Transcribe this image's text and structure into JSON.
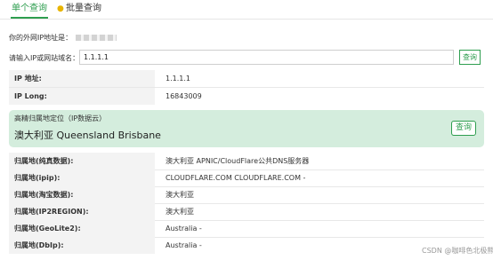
{
  "tabs": {
    "single_label": "单个查询",
    "batch_label": "批量查询"
  },
  "your_ip": {
    "label": "你的外网IP地址是："
  },
  "query": {
    "label": "请输入IP或网站域名：",
    "value": "1.1.1.1",
    "button_label": "查询"
  },
  "basic_rows": [
    {
      "key": "IP 地址:",
      "value": "1.1.1.1"
    },
    {
      "key": "IP Long:",
      "value": "16843009"
    }
  ],
  "location_card": {
    "title": "高精归属地定位（IP数据云）",
    "value": "澳大利亚 Queensland Brisbane",
    "button_label": "查询"
  },
  "source_rows": [
    {
      "key": "归属地(纯真数据):",
      "value": "澳大利亚 APNIC/CloudFlare公共DNS服务器"
    },
    {
      "key": "归属地(ipip):",
      "value": "CLOUDFLARE.COM CLOUDFLARE.COM -"
    },
    {
      "key": "归属地(淘宝数据):",
      "value": "澳大利亚"
    },
    {
      "key": "归属地(IP2REGION):",
      "value": "澳大利亚"
    },
    {
      "key": "归属地(GeoLite2):",
      "value": "Australia -"
    },
    {
      "key": "归属地(DbIp):",
      "value": "Australia -"
    }
  ],
  "watermark": "CSDN @咖啡色北极熊",
  "colors": {
    "accent": "#2e9e4f",
    "card_background": "#d4eddd",
    "key_cell_background": "#f3f3f3"
  }
}
